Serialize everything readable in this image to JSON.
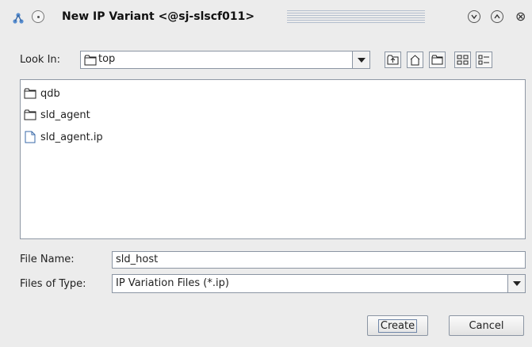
{
  "window": {
    "title": "New IP Variant <@sj-slscf011>",
    "close_glyph": "⊗"
  },
  "look_in": {
    "label": "Look In:",
    "mnemonic": "L",
    "value": "top"
  },
  "toolbar": {
    "icons": [
      "up-folder-icon",
      "home-icon",
      "new-folder-icon",
      "list-view-icon",
      "details-view-icon"
    ]
  },
  "files": [
    {
      "name": "qdb",
      "type": "folder"
    },
    {
      "name": "sld_agent",
      "type": "folder"
    },
    {
      "name": "sld_agent.ip",
      "type": "file"
    }
  ],
  "file_name": {
    "label": "File Name:",
    "value": "sld_host"
  },
  "files_of_type": {
    "label": "Files of Type:",
    "value": "IP Variation Files (*.ip)"
  },
  "buttons": {
    "create": "Create",
    "cancel": "Cancel"
  }
}
